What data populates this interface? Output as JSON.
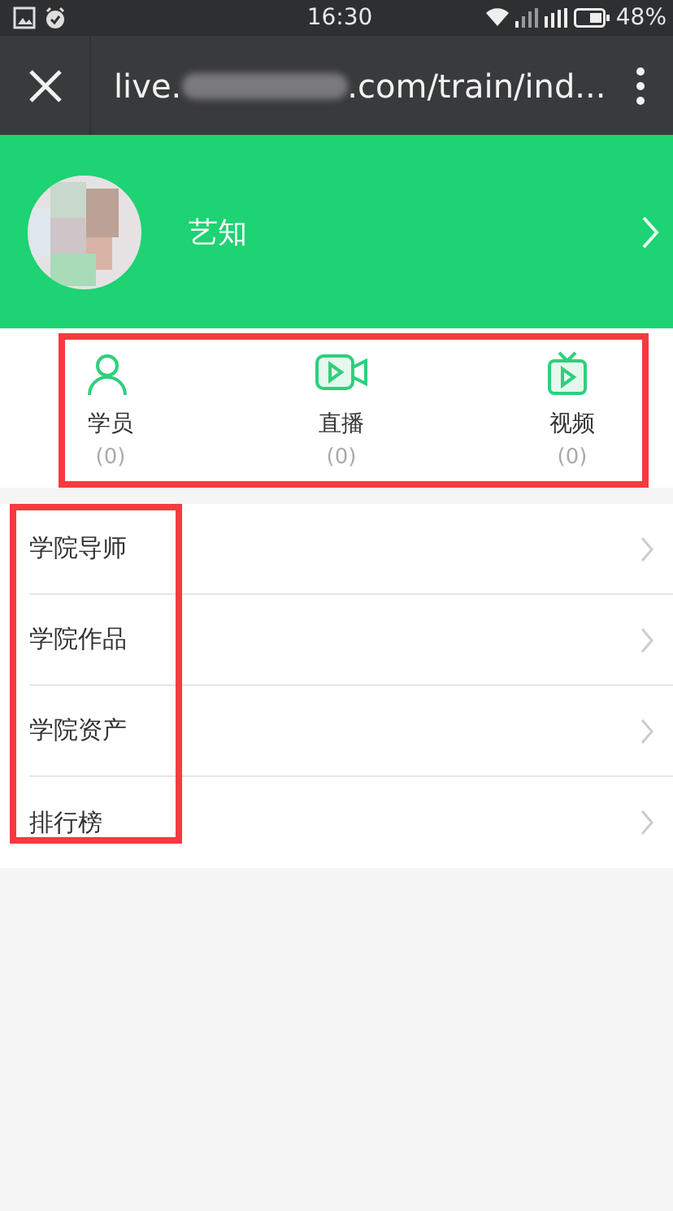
{
  "status_bar": {
    "time": "16:30",
    "battery": "48%"
  },
  "browser_bar": {
    "url_start": "live.",
    "url_end": ".com/train/ind...",
    "redacted": true
  },
  "profile": {
    "name": "艺知"
  },
  "stats": {
    "highlight": true,
    "items": [
      {
        "label": "学员",
        "count": "(0)"
      },
      {
        "label": "直播",
        "count": "(0)"
      },
      {
        "label": "视频",
        "count": "(0)"
      }
    ]
  },
  "menu": {
    "highlight": true,
    "items": [
      {
        "label": "学院导师"
      },
      {
        "label": "学院作品"
      },
      {
        "label": "学院资产"
      },
      {
        "label": "排行榜"
      }
    ]
  }
}
